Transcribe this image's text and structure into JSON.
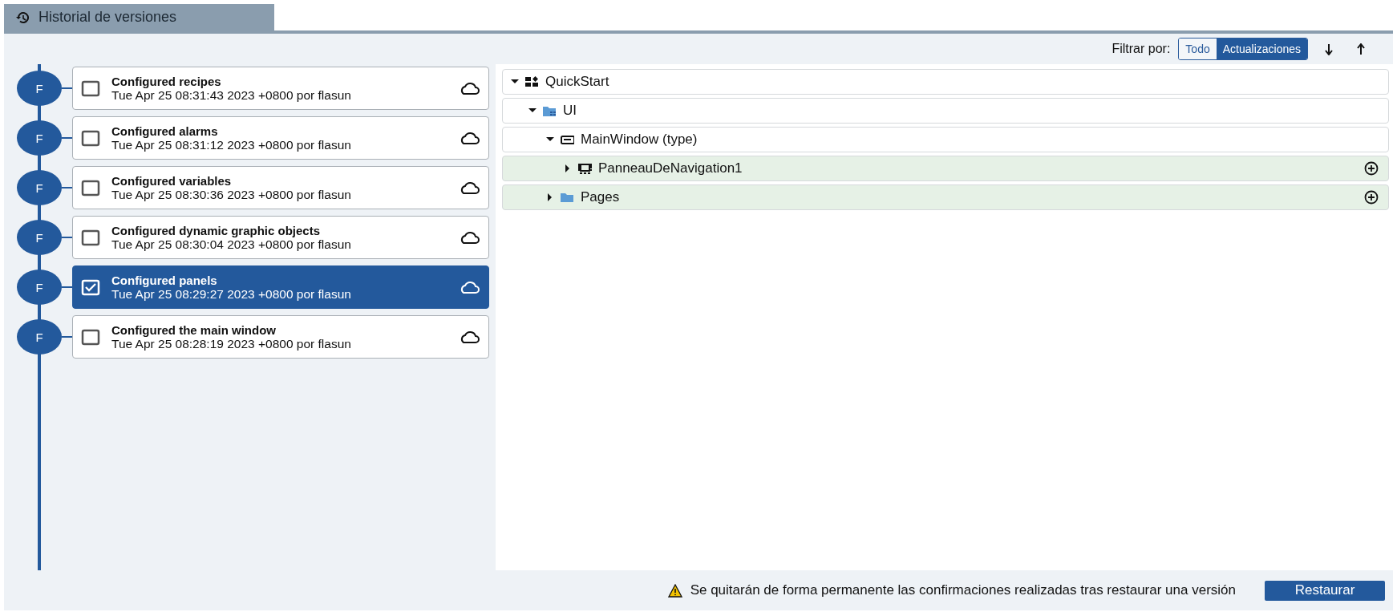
{
  "tab": {
    "label": "Historial de versiones",
    "selected": true
  },
  "filter": {
    "label": "Filtrar por:",
    "options": [
      {
        "label": "Todo",
        "selected": false
      },
      {
        "label": "Actualizaciones",
        "selected": true
      }
    ]
  },
  "versions": [
    {
      "avatar": "F",
      "title": "Configured recipes",
      "subtitle": "Tue Apr 25 08:31:43 2023 +0800 por flasun",
      "selected": false
    },
    {
      "avatar": "F",
      "title": "Configured alarms",
      "subtitle": "Tue Apr 25 08:31:12 2023 +0800 por flasun",
      "selected": false
    },
    {
      "avatar": "F",
      "title": "Configured variables",
      "subtitle": "Tue Apr 25 08:30:36 2023 +0800 por flasun",
      "selected": false
    },
    {
      "avatar": "F",
      "title": "Configured dynamic graphic objects",
      "subtitle": "Tue Apr 25 08:30:04 2023 +0800 por flasun",
      "selected": false
    },
    {
      "avatar": "F",
      "title": "Configured panels",
      "subtitle": "Tue Apr 25 08:29:27 2023 +0800 por flasun",
      "selected": true
    },
    {
      "avatar": "F",
      "title": "Configured the main window",
      "subtitle": "Tue Apr 25 08:28:19 2023 +0800 por flasun",
      "selected": false
    }
  ],
  "tree": [
    {
      "label": "QuickStart",
      "kind": "project",
      "expanded": true,
      "added": false,
      "children": [
        {
          "label": "UI",
          "kind": "ui-folder",
          "expanded": true,
          "added": false,
          "children": [
            {
              "label": "MainWindow (type)",
              "kind": "window",
              "expanded": true,
              "added": false,
              "children": [
                {
                  "label": "PanneauDeNavigation1",
                  "kind": "panel",
                  "expanded": false,
                  "added": true
                }
              ]
            },
            {
              "label": "Pages",
              "kind": "folder",
              "expanded": false,
              "added": true
            }
          ]
        }
      ]
    }
  ],
  "footer": {
    "warning": "Se quitarán de forma permanente las confirmaciones realizadas tras restaurar una versión",
    "button": "Restaurar"
  }
}
